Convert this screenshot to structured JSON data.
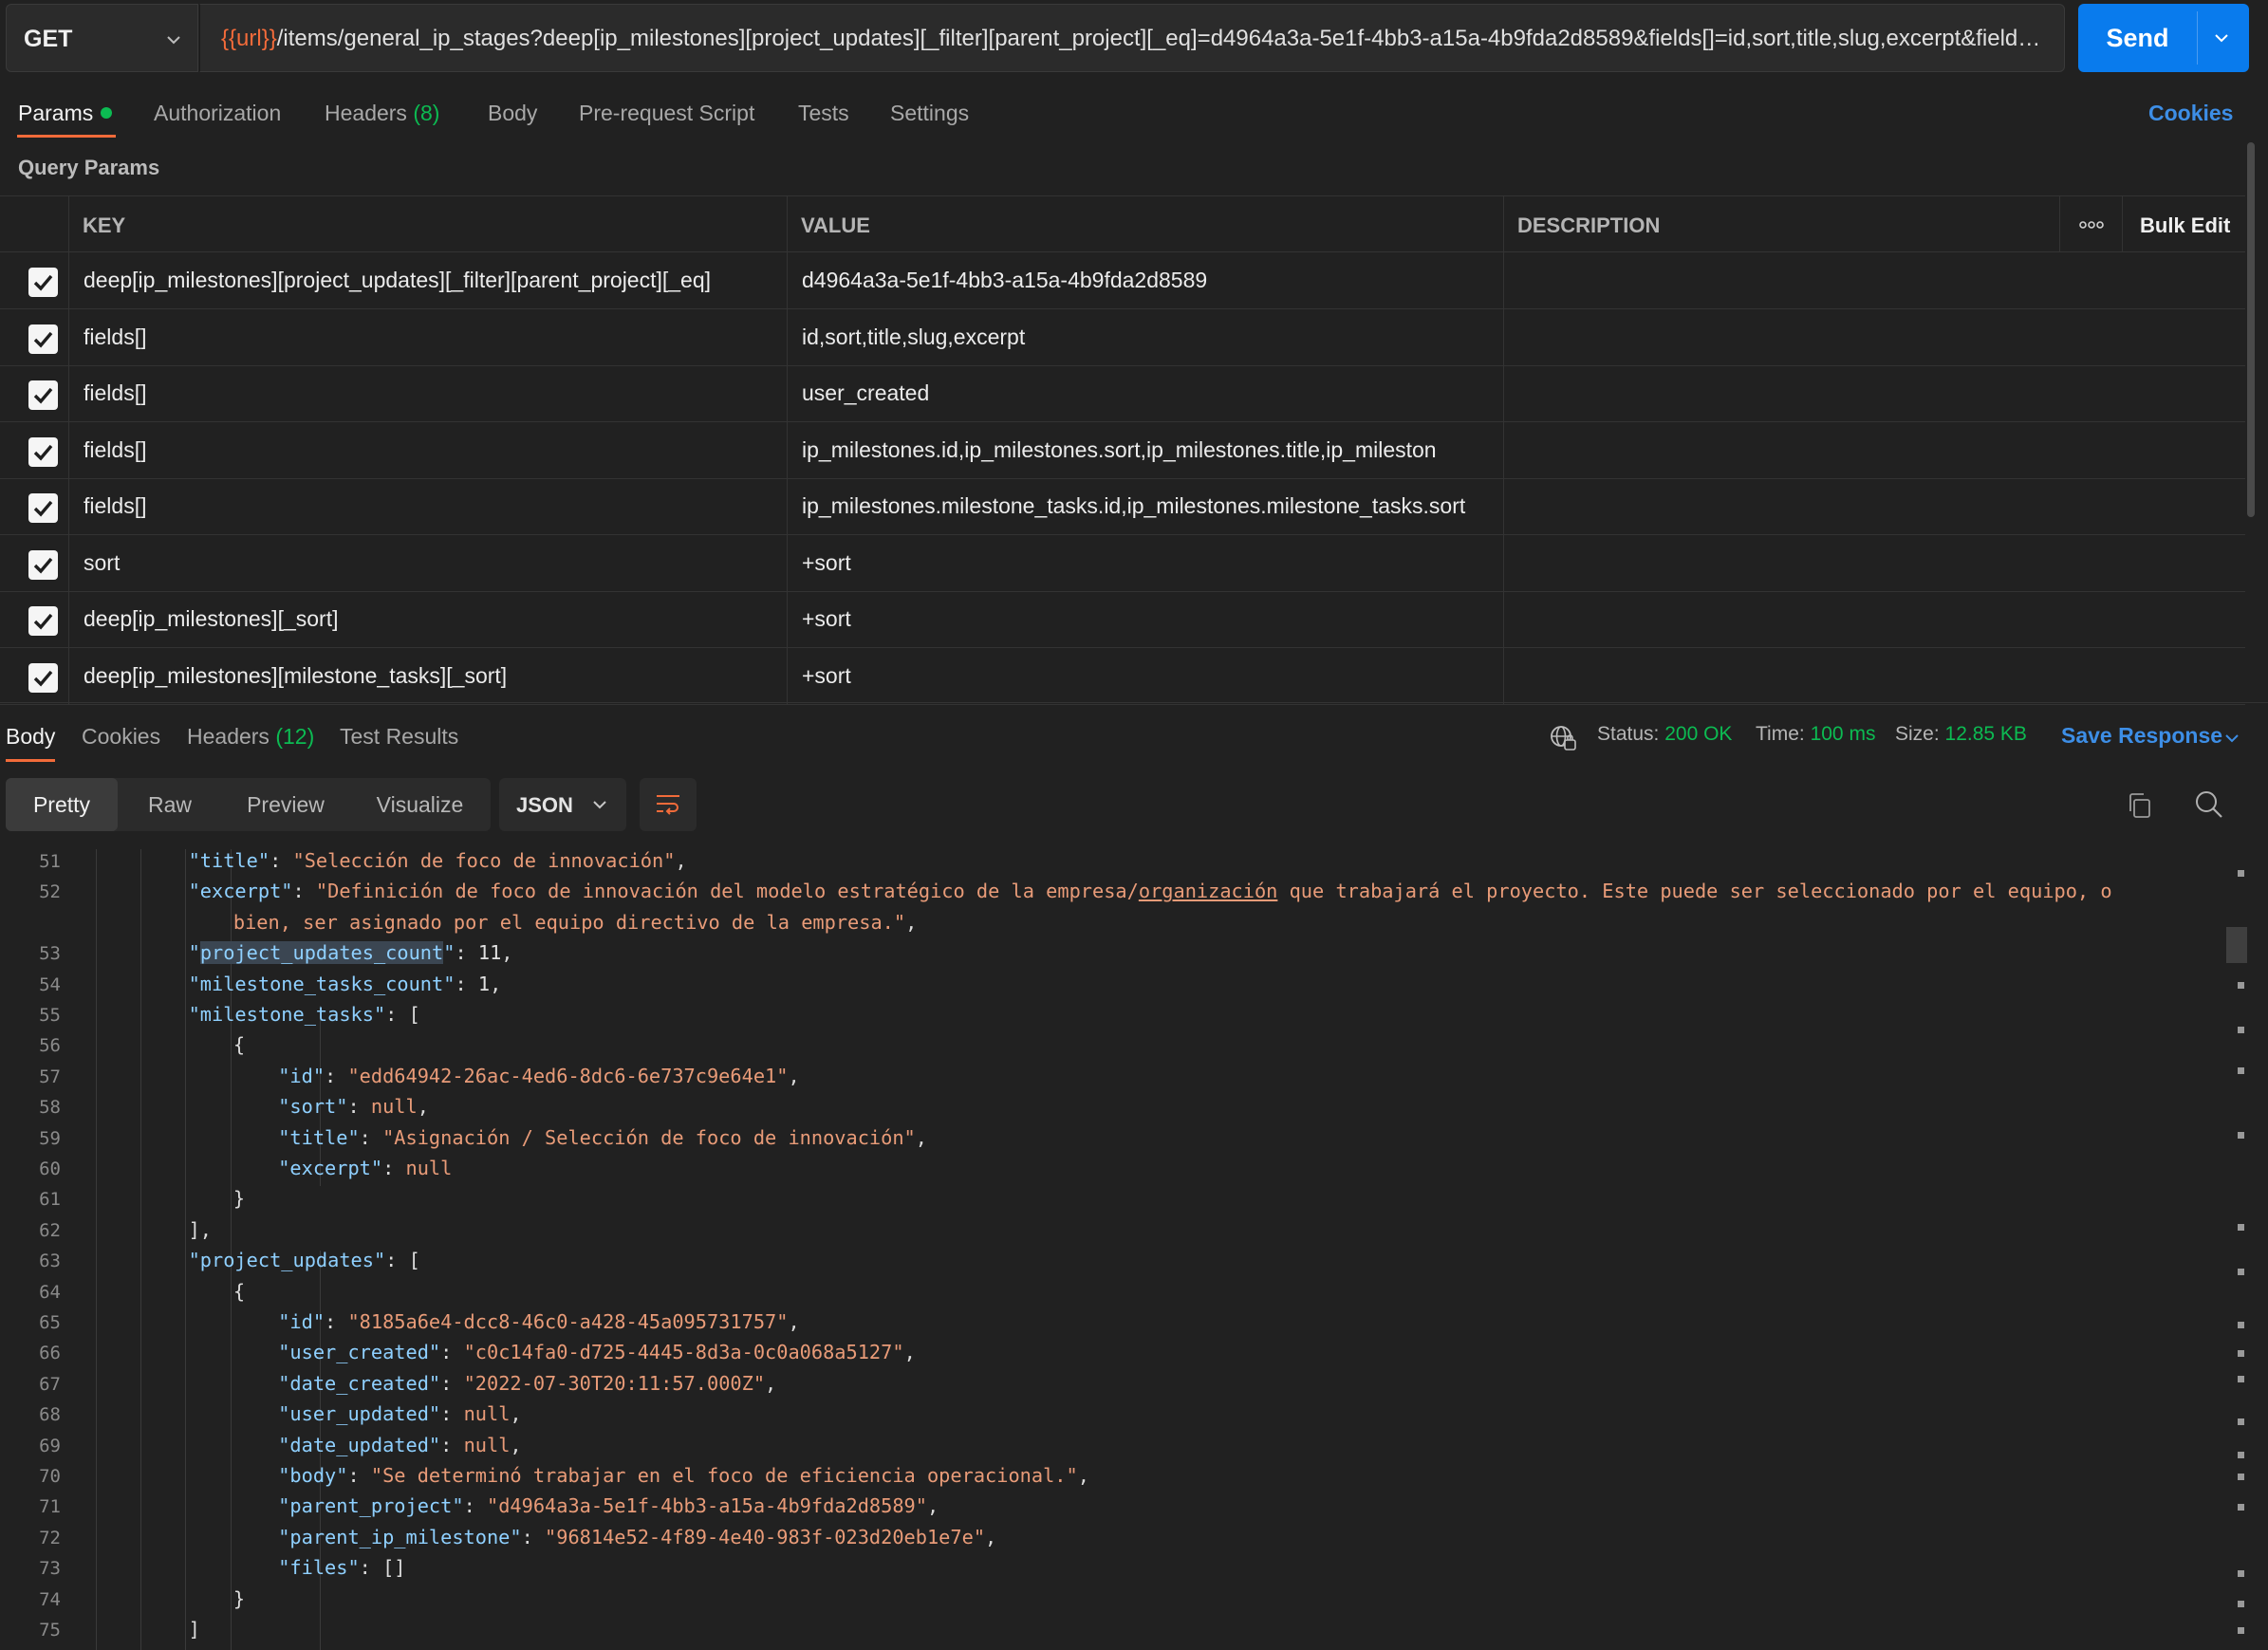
{
  "request": {
    "method": "GET",
    "url_var": "{{url}}",
    "url_rest": "/items/general_ip_stages?deep[ip_milestones][project_updates][_filter][parent_project][_eq]=d4964a3a-5e1f-4bb3-a15a-4b9fda2d8589&fields[]=id,sort,title,slug,excerpt&fields[]=u...",
    "send_label": "Send"
  },
  "tabs": {
    "params": "Params",
    "authorization": "Authorization",
    "headers": "Headers",
    "headers_count": "(8)",
    "body": "Body",
    "prerequest": "Pre-request Script",
    "tests": "Tests",
    "settings": "Settings",
    "cookies": "Cookies"
  },
  "params": {
    "title": "Query Params",
    "columns": {
      "key": "KEY",
      "value": "VALUE",
      "description": "DESCRIPTION",
      "bulk_edit": "Bulk Edit"
    },
    "rows": [
      {
        "key": "deep[ip_milestones][project_updates][_filter][parent_project][_eq]",
        "value": "d4964a3a-5e1f-4bb3-a15a-4b9fda2d8589"
      },
      {
        "key": "fields[]",
        "value": "id,sort,title,slug,excerpt"
      },
      {
        "key": "fields[]",
        "value": "user_created"
      },
      {
        "key": "fields[]",
        "value": "ip_milestones.id,ip_milestones.sort,ip_milestones.title,ip_mileston"
      },
      {
        "key": "fields[]",
        "value": "ip_milestones.milestone_tasks.id,ip_milestones.milestone_tasks.sort"
      },
      {
        "key": "sort",
        "value": "+sort"
      },
      {
        "key": "deep[ip_milestones][_sort]",
        "value": "+sort"
      },
      {
        "key": "deep[ip_milestones][milestone_tasks][_sort]",
        "value": "+sort"
      }
    ]
  },
  "response": {
    "tabs": {
      "body": "Body",
      "cookies": "Cookies",
      "headers": "Headers",
      "headers_count": "(12)",
      "test_results": "Test Results"
    },
    "status_label": "Status:",
    "status_value": "200 OK",
    "time_label": "Time:",
    "time_value": "100 ms",
    "size_label": "Size:",
    "size_value": "12.85 KB",
    "save_response": "Save Response",
    "views": {
      "pretty": "Pretty",
      "raw": "Raw",
      "preview": "Preview",
      "visualize": "Visualize"
    },
    "format": "JSON"
  },
  "code_lines": [
    {
      "n": "51",
      "indent": 5,
      "t": [
        [
          "k",
          "\"title\""
        ],
        [
          "p",
          ": "
        ],
        [
          "s",
          "\"Selección de foco de innovación\""
        ],
        [
          "p",
          ","
        ]
      ]
    },
    {
      "n": "52",
      "indent": 5,
      "t": [
        [
          "k",
          "\"excerpt\""
        ],
        [
          "p",
          ": "
        ],
        [
          "s",
          "\"Definición de foco de innovación del modelo estratégico de la empresa/"
        ],
        [
          "su",
          "organización"
        ],
        [
          "s",
          " que trabajará el proyecto. Este puede ser seleccionado por el equipo, o"
        ]
      ]
    },
    {
      "n": "",
      "indent": 6,
      "t": [
        [
          "s",
          "bien, ser asignado por el equipo directivo de la empresa.\""
        ],
        [
          "p",
          ","
        ]
      ]
    },
    {
      "n": "53",
      "indent": 5,
      "t": [
        [
          "k",
          "\""
        ],
        [
          "ksel",
          "project_updates_count"
        ],
        [
          "k",
          "\""
        ],
        [
          "p",
          ": "
        ],
        [
          "n",
          "11"
        ],
        [
          "p",
          ","
        ]
      ]
    },
    {
      "n": "54",
      "indent": 5,
      "t": [
        [
          "k",
          "\"milestone_tasks_count\""
        ],
        [
          "p",
          ": "
        ],
        [
          "n",
          "1"
        ],
        [
          "p",
          ","
        ]
      ]
    },
    {
      "n": "55",
      "indent": 5,
      "t": [
        [
          "k",
          "\"milestone_tasks\""
        ],
        [
          "p",
          ": ["
        ]
      ]
    },
    {
      "n": "56",
      "indent": 6,
      "t": [
        [
          "p",
          "{"
        ]
      ]
    },
    {
      "n": "57",
      "indent": 7,
      "t": [
        [
          "k",
          "\"id\""
        ],
        [
          "p",
          ": "
        ],
        [
          "s",
          "\"edd64942-26ac-4ed6-8dc6-6e737c9e64e1\""
        ],
        [
          "p",
          ","
        ]
      ]
    },
    {
      "n": "58",
      "indent": 7,
      "t": [
        [
          "k",
          "\"sort\""
        ],
        [
          "p",
          ": "
        ],
        [
          "nl",
          "null"
        ],
        [
          "p",
          ","
        ]
      ]
    },
    {
      "n": "59",
      "indent": 7,
      "t": [
        [
          "k",
          "\"title\""
        ],
        [
          "p",
          ": "
        ],
        [
          "s",
          "\"Asignación / Selección de foco de innovación\""
        ],
        [
          "p",
          ","
        ]
      ]
    },
    {
      "n": "60",
      "indent": 7,
      "t": [
        [
          "k",
          "\"excerpt\""
        ],
        [
          "p",
          ": "
        ],
        [
          "nl",
          "null"
        ]
      ]
    },
    {
      "n": "61",
      "indent": 6,
      "t": [
        [
          "p",
          "}"
        ]
      ]
    },
    {
      "n": "62",
      "indent": 5,
      "t": [
        [
          "p",
          "],"
        ]
      ]
    },
    {
      "n": "63",
      "indent": 5,
      "t": [
        [
          "k",
          "\"project_updates\""
        ],
        [
          "p",
          ": ["
        ]
      ]
    },
    {
      "n": "64",
      "indent": 6,
      "t": [
        [
          "p",
          "{"
        ]
      ]
    },
    {
      "n": "65",
      "indent": 7,
      "t": [
        [
          "k",
          "\"id\""
        ],
        [
          "p",
          ": "
        ],
        [
          "s",
          "\"8185a6e4-dcc8-46c0-a428-45a095731757\""
        ],
        [
          "p",
          ","
        ]
      ]
    },
    {
      "n": "66",
      "indent": 7,
      "t": [
        [
          "k",
          "\"user_created\""
        ],
        [
          "p",
          ": "
        ],
        [
          "s",
          "\"c0c14fa0-d725-4445-8d3a-0c0a068a5127\""
        ],
        [
          "p",
          ","
        ]
      ]
    },
    {
      "n": "67",
      "indent": 7,
      "t": [
        [
          "k",
          "\"date_created\""
        ],
        [
          "p",
          ": "
        ],
        [
          "s",
          "\"2022-07-30T20:11:57.000Z\""
        ],
        [
          "p",
          ","
        ]
      ]
    },
    {
      "n": "68",
      "indent": 7,
      "t": [
        [
          "k",
          "\"user_updated\""
        ],
        [
          "p",
          ": "
        ],
        [
          "nl",
          "null"
        ],
        [
          "p",
          ","
        ]
      ]
    },
    {
      "n": "69",
      "indent": 7,
      "t": [
        [
          "k",
          "\"date_updated\""
        ],
        [
          "p",
          ": "
        ],
        [
          "nl",
          "null"
        ],
        [
          "p",
          ","
        ]
      ]
    },
    {
      "n": "70",
      "indent": 7,
      "t": [
        [
          "k",
          "\"body\""
        ],
        [
          "p",
          ": "
        ],
        [
          "s",
          "\"Se determinó trabajar en el foco de eficiencia operacional.\""
        ],
        [
          "p",
          ","
        ]
      ]
    },
    {
      "n": "71",
      "indent": 7,
      "t": [
        [
          "k",
          "\"parent_project\""
        ],
        [
          "p",
          ": "
        ],
        [
          "s",
          "\"d4964a3a-5e1f-4bb3-a15a-4b9fda2d8589\""
        ],
        [
          "p",
          ","
        ]
      ]
    },
    {
      "n": "72",
      "indent": 7,
      "t": [
        [
          "k",
          "\"parent_ip_milestone\""
        ],
        [
          "p",
          ": "
        ],
        [
          "s",
          "\"96814e52-4f89-4e40-983f-023d20eb1e7e\""
        ],
        [
          "p",
          ","
        ]
      ]
    },
    {
      "n": "73",
      "indent": 7,
      "t": [
        [
          "k",
          "\"files\""
        ],
        [
          "p",
          ": []"
        ]
      ]
    },
    {
      "n": "74",
      "indent": 6,
      "t": [
        [
          "p",
          "}"
        ]
      ]
    },
    {
      "n": "75",
      "indent": 5,
      "t": [
        [
          "p",
          "]"
        ]
      ]
    }
  ],
  "icons": {
    "method_dropdown": "chevron-down-icon",
    "send_dropdown": "chevron-down-icon",
    "globe": "globe-icon",
    "wrap": "wrap-lines-icon",
    "copy": "copy-icon",
    "search": "search-icon",
    "more": "more-horizontal-icon",
    "check": "check-icon"
  },
  "colors": {
    "accent_orange": "#f26b3a",
    "send_blue": "#097bed",
    "link_blue": "#3d8ee6",
    "status_green": "#0cbb52",
    "json_key": "#8fd0ff",
    "json_string": "#e89b78"
  }
}
